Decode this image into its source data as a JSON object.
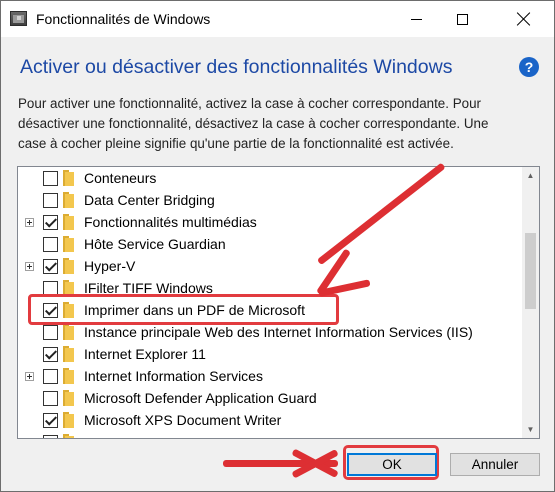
{
  "window": {
    "title": "Fonctionnalités de Windows",
    "controls": {
      "minimize": "minimize",
      "maximize": "maximize",
      "close": "close"
    }
  },
  "header": {
    "heading": "Activer ou désactiver des fonctionnalités Windows",
    "help": "?"
  },
  "description": {
    "line1": "Pour activer une fonctionnalité, activez la case à cocher correspondante. Pour",
    "line2": "désactiver une fonctionnalité, désactivez la case à cocher correspondante. Une",
    "line3": "case à cocher pleine signifie qu'une partie de la fonctionnalité est activée."
  },
  "features": [
    {
      "label": "Conteneurs",
      "checked": false,
      "expandable": false
    },
    {
      "label": "Data Center Bridging",
      "checked": false,
      "expandable": false
    },
    {
      "label": "Fonctionnalités multimédias",
      "checked": true,
      "expandable": true
    },
    {
      "label": "Hôte Service Guardian",
      "checked": false,
      "expandable": false
    },
    {
      "label": "Hyper-V",
      "checked": true,
      "expandable": true
    },
    {
      "label": "IFilter TIFF Windows",
      "checked": false,
      "expandable": false
    },
    {
      "label": "Imprimer dans un PDF de Microsoft",
      "checked": true,
      "expandable": false
    },
    {
      "label": "Instance principale Web des Internet Information Services (IIS)",
      "checked": false,
      "expandable": false
    },
    {
      "label": "Internet Explorer 11",
      "checked": true,
      "expandable": false
    },
    {
      "label": "Internet Information Services",
      "checked": false,
      "expandable": true
    },
    {
      "label": "Microsoft Defender Application Guard",
      "checked": false,
      "expandable": false
    },
    {
      "label": "Microsoft XPS Document Writer",
      "checked": true,
      "expandable": false
    },
    {
      "label": "",
      "checked": false,
      "expandable": true
    }
  ],
  "buttons": {
    "ok": "OK",
    "cancel": "Annuler"
  },
  "colors": {
    "heading": "#1d49a5",
    "highlight": "#e23b3f",
    "help": "#1a64c8",
    "focus": "#0078d7"
  },
  "icons": {
    "app": "windows-features-icon",
    "help": "help-icon",
    "folder": "folder-icon",
    "check": "checkmark-icon"
  }
}
